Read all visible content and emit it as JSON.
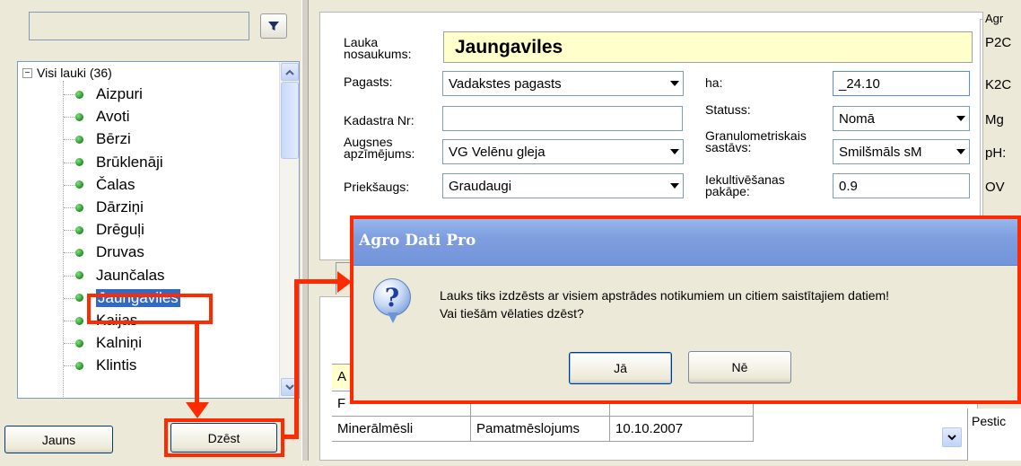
{
  "sidebar": {
    "search_value": "",
    "tree_root_label": "Visi lauki (36)",
    "tree_items": [
      {
        "label": "Aizpuri"
      },
      {
        "label": "Avoti"
      },
      {
        "label": "Bērzi"
      },
      {
        "label": "Brūklenāji"
      },
      {
        "label": "Čalas"
      },
      {
        "label": "Dārziņi"
      },
      {
        "label": "Drēguļi"
      },
      {
        "label": "Druvas"
      },
      {
        "label": "Jaunčalas"
      },
      {
        "label": "Jaungaviles"
      },
      {
        "label": "Kaijas"
      },
      {
        "label": "Kalniņi"
      },
      {
        "label": "Klintis"
      }
    ],
    "selected_item": "Jaungaviles",
    "new_button": "Jauns",
    "delete_button": "Dzēst"
  },
  "form": {
    "name_label": "Lauka nosaukums:",
    "name_value": "Jaungaviles",
    "parish_label": "Pagasts:",
    "parish_value": "Vadakstes pagasts",
    "ha_label": "ha:",
    "ha_value": "_24.10",
    "cadastre_label": "Kadastra Nr:",
    "cadastre_value": "",
    "status_label": "Statuss:",
    "status_value": "Nomā",
    "soil_label": "Augsnes apzīmējums:",
    "soil_value": "VG Velēnu gleja",
    "granulometric_label": "Granulometriskais sastāvs:",
    "granulometric_value": "Smilšmāls sM",
    "prev_crop_label": "Priekšaugs:",
    "prev_crop_value": "Graudaugi",
    "cultivation_label": "Iekultivēšanas pakāpe:",
    "cultivation_value": "0.9"
  },
  "agro_group": {
    "title": "Agr",
    "lines": [
      "P2C",
      "K2C",
      "Mg",
      "pH:",
      "OV"
    ]
  },
  "grid": {
    "rows": [
      [
        "A",
        "",
        ""
      ],
      [
        "F",
        "",
        ""
      ],
      [
        "Minerālmēsli",
        "Pamatmēslojums",
        "10.10.2007"
      ]
    ],
    "pestic_label": "Pestic"
  },
  "dialog": {
    "title": "Agro Dati Pro",
    "message_line1": "Lauks tiks izdzēsts ar visiem apstrādes notikumiem un citiem saistītajiem datiem!",
    "message_line2": "Vai tiešām vēlaties dzēst?",
    "yes_button": "Jā",
    "no_button": "Nē"
  },
  "colors": {
    "highlight": "#ff2a00",
    "selection": "#316ac5",
    "name_field_bg": "#ffffcc",
    "dialog_title": "#7e9ede"
  }
}
